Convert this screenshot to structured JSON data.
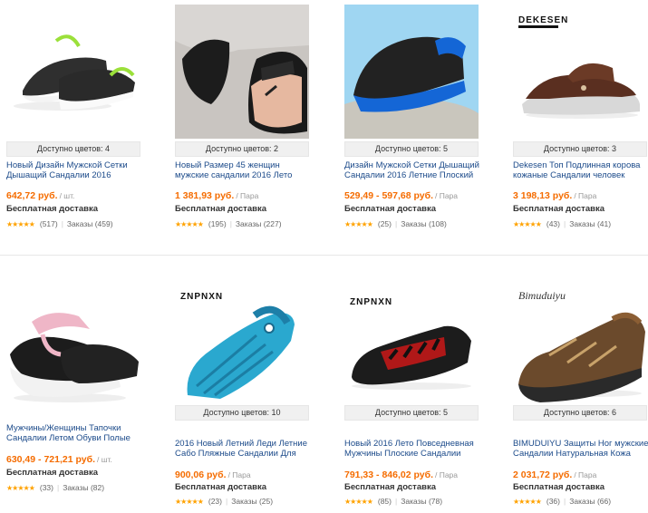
{
  "products": [
    {
      "colors_label": "Доступно цветов: 4",
      "title": "Новый Дизайн Мужской Сетки Дышащий Сандалии 2016",
      "price": "642,72 руб.",
      "unit": "/ шт.",
      "shipping": "Бесплатная доставка",
      "rating": "★★★★★",
      "reviews": "(517)",
      "orders": "Заказы (459)",
      "brand": "",
      "icon": "mesh-clog-icon"
    },
    {
      "colors_label": "Доступно цветов: 2",
      "title": "Новый Размер 45 женщин мужские сандалии 2016 Лето",
      "price": "1 381,93 руб.",
      "unit": "/ Пара",
      "shipping": "Бесплатная доставка",
      "rating": "★★★★★",
      "reviews": "(195)",
      "orders": "Заказы (227)",
      "brand": "",
      "icon": "flip-flop-sandal-icon"
    },
    {
      "colors_label": "Доступно цветов: 5",
      "title": "Дизайн Мужской Сетки Дышащий Сандалии 2016 Летние Плоский",
      "price": "529,49 - 597,68 руб.",
      "unit": "/ Пара",
      "shipping": "Бесплатная доставка",
      "rating": "★★★★★",
      "reviews": "(25)",
      "orders": "Заказы (108)",
      "brand": "",
      "icon": "blue-mesh-clog-icon"
    },
    {
      "colors_label": "Доступно цветов: 3",
      "title": "Dekesen Топ Подлинная корова кожаные Сандалии человек",
      "price": "3 198,13 руб.",
      "unit": "/ Пара",
      "shipping": "Бесплатная доставка",
      "rating": "★★★★★",
      "reviews": "(43)",
      "orders": "Заказы (41)",
      "brand": "DEKESEN",
      "icon": "leather-sandal-icon"
    },
    {
      "colors_label": "",
      "title": "Мужчины/Женщины Тапочки Сандалии Летом Обуви Полые",
      "price": "630,49 - 721,21 руб.",
      "unit": "/ шт.",
      "shipping": "Бесплатная доставка",
      "rating": "★★★★★",
      "reviews": "(33)",
      "orders": "Заказы (82)",
      "brand": "",
      "icon": "pink-clog-icon"
    },
    {
      "colors_label": "Доступно цветов: 10",
      "title": "2016 Новый Летний Леди Летние Сабо Пляжные Сандалии Для",
      "price": "900,06 руб.",
      "unit": "/ Пара",
      "shipping": "Бесплатная доставка",
      "rating": "★★★★★",
      "reviews": "(23)",
      "orders": "Заказы (25)",
      "brand": "ZNPNXN",
      "icon": "teal-clog-icon"
    },
    {
      "colors_label": "Доступно цветов: 5",
      "title": "Новый 2016 Лето Повседневная Мужчины Плоские Сандалии",
      "price": "791,33 - 846,02 руб.",
      "unit": "/ Пара",
      "shipping": "Бесплатная доставка",
      "rating": "★★★★★",
      "reviews": "(85)",
      "orders": "Заказы (78)",
      "brand": "ZNPNXN",
      "icon": "black-red-shoe-icon"
    },
    {
      "colors_label": "Доступно цветов: 6",
      "title": "BIMUDUIYU Защиты Ног мужские Сандалии Натуральная Кожа",
      "price": "2 031,72 руб.",
      "unit": "/ Пара",
      "shipping": "Бесплатная доставка",
      "rating": "★★★★★",
      "reviews": "(36)",
      "orders": "Заказы (66)",
      "brand": "Bimuduiyu",
      "icon": "brown-sport-sandal-icon"
    }
  ],
  "colors": {
    "price": "#f56c00",
    "title_link": "#1b4a8a",
    "stars": "#ffa200"
  }
}
